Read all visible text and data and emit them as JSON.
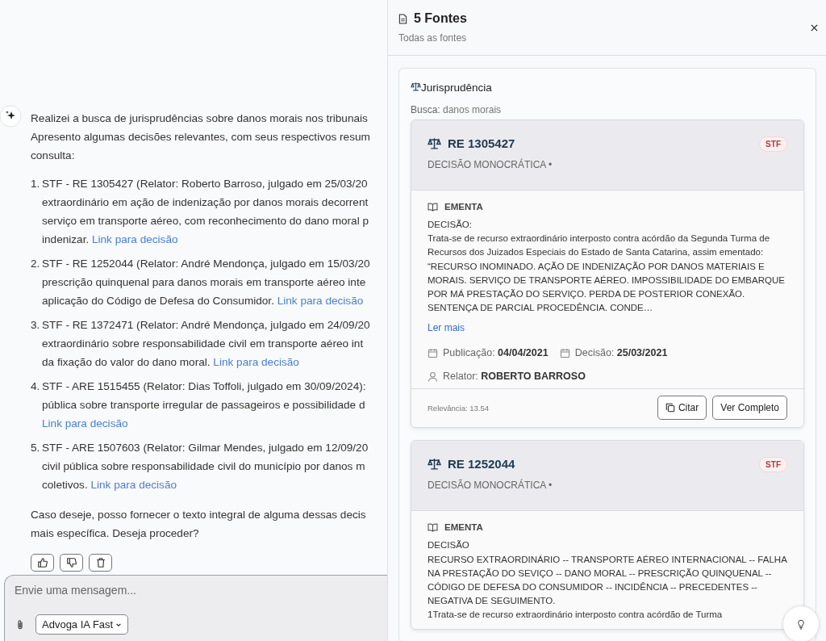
{
  "chat": {
    "intro": [
      "Realizei a busca de jurisprudências sobre danos morais nos tribunais",
      "Apresento algumas decisões relevantes, com seus respectivos resum",
      "consulta:"
    ],
    "items": [
      {
        "number": "1.",
        "lines": [
          {
            "text": "STF - RE 1305427 (Relator: Roberto Barroso, julgado em 25/03/20"
          },
          {
            "text": "extraordinário em ação de indenização por danos morais decorrent"
          },
          {
            "text": "serviço em transporte aéreo, com reconhecimento do dano moral p"
          },
          {
            "text": "indenizar.",
            "link": "Link para decisão"
          }
        ]
      },
      {
        "number": "2.",
        "lines": [
          {
            "text": "STF - RE 1252044 (Relator: André Mendonça, julgado em 15/03/20"
          },
          {
            "text": "prescrição quinquenal para danos morais em transporte aéreo inte"
          },
          {
            "text": "aplicação do Código de Defesa do Consumidor.",
            "link": "Link para decisão"
          }
        ]
      },
      {
        "number": "3.",
        "lines": [
          {
            "text": "STF - RE 1372471 (Relator: André Mendonça, julgado em 24/09/20"
          },
          {
            "text": "extraordinário sobre responsabilidade civil em transporte aéreo int"
          },
          {
            "text": "da fixação do valor do dano moral.",
            "link": "Link para decisão"
          }
        ]
      },
      {
        "number": "4.",
        "lines": [
          {
            "text": "STF - ARE 1515455 (Relator: Dias Toffoli, julgado em 30/09/2024):"
          },
          {
            "text": "pública sobre transporte irregular de passageiros e possibilidade d"
          },
          {
            "link": "Link para decisão"
          }
        ]
      },
      {
        "number": "5.",
        "lines": [
          {
            "text": "STF - ARE 1507603 (Relator: Gilmar Mendes, julgado em 12/09/20"
          },
          {
            "text": "civil pública sobre responsabilidade civil do município por danos m"
          },
          {
            "text": "coletivos.",
            "link": "Link para decisão"
          }
        ]
      }
    ],
    "closing": [
      "Caso deseje, posso fornecer o texto integral de alguma dessas decis",
      "mais específica. Deseja proceder?"
    ],
    "input": {
      "placeholder": "Envie uma mensagem..."
    },
    "model_select": "Advoga IA Fast"
  },
  "sources_panel": {
    "title": "5 Fontes",
    "subtitle": "Todas as fontes",
    "section": {
      "title": "Jurisprudência",
      "query_label": "Busca:",
      "query": "danos morais",
      "results": [
        {
          "title": "RE 1305427",
          "court": "STF",
          "type": "DECISÃO MONOCRÁTICA •",
          "ementa_label": "EMENTA",
          "ementa": "DECISÃO:\nTrata-se de recurso extraordinário interposto contra acórdão da Segunda Turma de Recursos dos Juizados Especiais do Estado de Santa Catarina, assim ementado:\n“RECURSO INOMINADO. AÇÃO DE INDENIZAÇÃO POR DANOS MATERIAIS E MORAIS. SERVIÇO DE TRANSPORTE AÉREO. IMPOSSIBILIDADE DO EMBARQUE POR MÁ PRESTAÇÃO DO SERVIÇO. PERDA DE POSTERIOR CONEXÃO. SENTENÇA DE PARCIAL PROCEDÊNCIA. CONDE…",
          "read_more": "Ler mais",
          "publication_label": "Publicação:",
          "publication": "04/04/2021",
          "decision_label": "Decisão:",
          "decision": "25/03/2021",
          "rapporteur_label": "Relator:",
          "rapporteur": "ROBERTO BARROSO",
          "relevance": "Relevância: 13.54",
          "cite_button": "Citar",
          "full_button": "Ver Completo"
        },
        {
          "title": "RE 1252044",
          "court": "STF",
          "type": "DECISÃO MONOCRÁTICA •",
          "ementa_label": "EMENTA",
          "ementa": "DECISÃO\nRECURSO EXTRAORDINÁRIO -- TRANSPORTE AÉREO INTERNACIONAL -- FALHA NA PRESTAÇÃO DO SEVIÇO -- DANO MORAL -- PRESCRIÇÃO QUINQUENAL -- CÓDIGO DE DEFESA DO CONSUMIDOR -- INCIDÊNCIA -- PRECEDENTES -- NEGATIVA DE SEGUIMENTO.\n1Trata-se de recurso extraordinário interposto contra acórdão de Turma"
        }
      ]
    }
  }
}
